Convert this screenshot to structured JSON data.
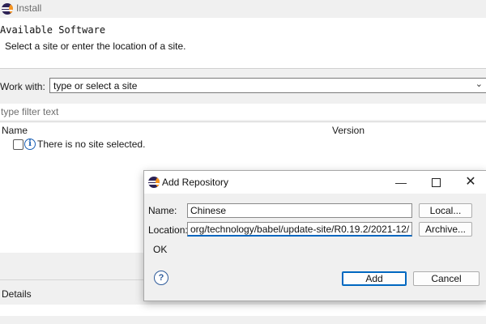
{
  "main_window": {
    "title": "Install",
    "heading": "Available Software",
    "description": "Select a site or enter the location of a site.",
    "work_with_label": "Work with:",
    "work_with_value": "type or select a site",
    "filter_placeholder": "type filter text",
    "table": {
      "columns": [
        "Name",
        "Version"
      ],
      "empty_message": "There is no site selected."
    },
    "details_label": "Details"
  },
  "dialog": {
    "title": "Add Repository",
    "name_label": "Name:",
    "name_value": "Chinese",
    "location_label": "Location:",
    "location_value": "org/technology/babel/update-site/R0.19.2/2021-12/",
    "status_text": "OK",
    "local_button": "Local...",
    "archive_button": "Archive...",
    "add_button": "Add",
    "cancel_button": "Cancel",
    "minimize_glyph": "—",
    "close_glyph": "✕",
    "help_glyph": "?"
  },
  "icons": {
    "app_logo": "eclipse-logo-icon",
    "info": "info-icon",
    "help": "help-icon",
    "dropdown": "chevron-down-icon"
  },
  "colors": {
    "accent": "#0067c0",
    "logo_dark": "#2c2255",
    "logo_orange": "#f7941e"
  }
}
